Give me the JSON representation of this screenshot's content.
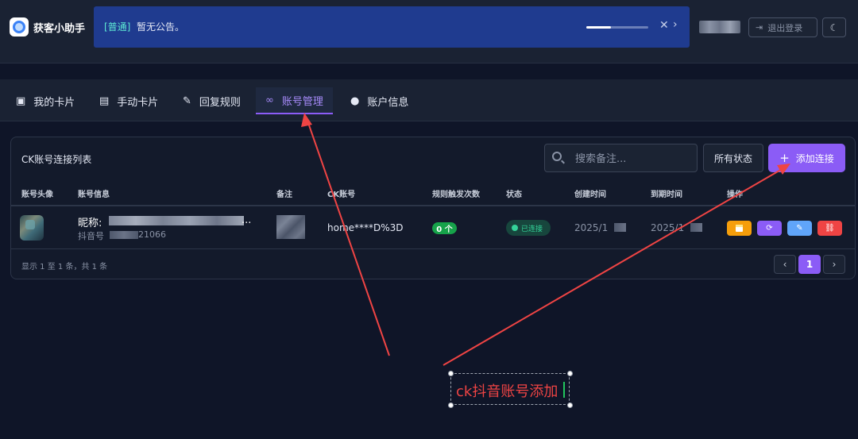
{
  "app": {
    "title": "获客小助手"
  },
  "notice": {
    "tag": "[普通]",
    "text": "暂无公告。",
    "progress": 0.4
  },
  "header": {
    "logout_label": "退出登录"
  },
  "tabs": [
    {
      "label": "我的卡片",
      "icon": "id-card-icon"
    },
    {
      "label": "手动卡片",
      "icon": "image-icon"
    },
    {
      "label": "回复规则",
      "icon": "edit-icon"
    },
    {
      "label": "账号管理",
      "icon": "link-icon",
      "active": true
    },
    {
      "label": "账户信息",
      "icon": "user-icon"
    }
  ],
  "card": {
    "title": "CK账号连接列表",
    "search_placeholder": "搜索备注...",
    "status_filter": "所有状态",
    "add_label": "添加连接"
  },
  "table": {
    "columns": [
      "账号头像",
      "账号信息",
      "备注",
      "CK账号",
      "规则触发次数",
      "状态",
      "创建时间",
      "到期时间",
      "操作"
    ],
    "rows": [
      {
        "nickname_prefix": "昵称:",
        "nickname_tail": "...",
        "douyin_prefix": "抖音号",
        "douyin_suffix": "21066",
        "ck": "home****D%3D",
        "count": "0 个",
        "status": "已连接",
        "created": "2025/1",
        "expires": "2025/1"
      }
    ],
    "summary": "显示 1 至 1 条，共 1 条"
  },
  "pagination": {
    "prev": "‹",
    "current": "1",
    "next": "›"
  },
  "annotation": {
    "text": "ck抖音账号添加"
  },
  "colors": {
    "accent": "#8b5cf6",
    "notice_bg": "#1f3b8f",
    "success": "#16a34a",
    "danger": "#ef4444",
    "annotation": "#ef4444"
  }
}
